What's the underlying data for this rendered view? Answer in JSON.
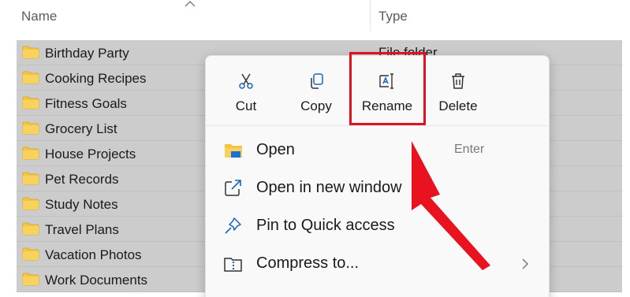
{
  "header": {
    "name_label": "Name",
    "type_label": "Type"
  },
  "files": [
    {
      "name": "Birthday Party",
      "type": "File folder"
    },
    {
      "name": "Cooking Recipes",
      "type": ""
    },
    {
      "name": "Fitness Goals",
      "type": ""
    },
    {
      "name": "Grocery List",
      "type": ""
    },
    {
      "name": "House Projects",
      "type": ""
    },
    {
      "name": "Pet Records",
      "type": ""
    },
    {
      "name": "Study Notes",
      "type": ""
    },
    {
      "name": "Travel Plans",
      "type": ""
    },
    {
      "name": "Vacation Photos",
      "type": ""
    },
    {
      "name": "Work Documents",
      "type": ""
    }
  ],
  "context_menu": {
    "quick_actions": [
      {
        "label": "Cut",
        "icon": "scissors-icon"
      },
      {
        "label": "Copy",
        "icon": "copy-icon"
      },
      {
        "label": "Rename",
        "icon": "rename-icon"
      },
      {
        "label": "Delete",
        "icon": "trash-icon"
      }
    ],
    "items": [
      {
        "label": "Open",
        "shortcut": "Enter",
        "icon": "folder-icon"
      },
      {
        "label": "Open in new window",
        "shortcut": "",
        "icon": "open-new-window-icon"
      },
      {
        "label": "Pin to Quick access",
        "shortcut": "",
        "icon": "pin-icon"
      },
      {
        "label": "Compress to...",
        "shortcut": "",
        "icon": "zip-folder-icon"
      }
    ]
  },
  "colors": {
    "selection": "#cccccc",
    "folder": "#f4c542",
    "accent": "#1565c0",
    "annotation": "#e0121f"
  }
}
